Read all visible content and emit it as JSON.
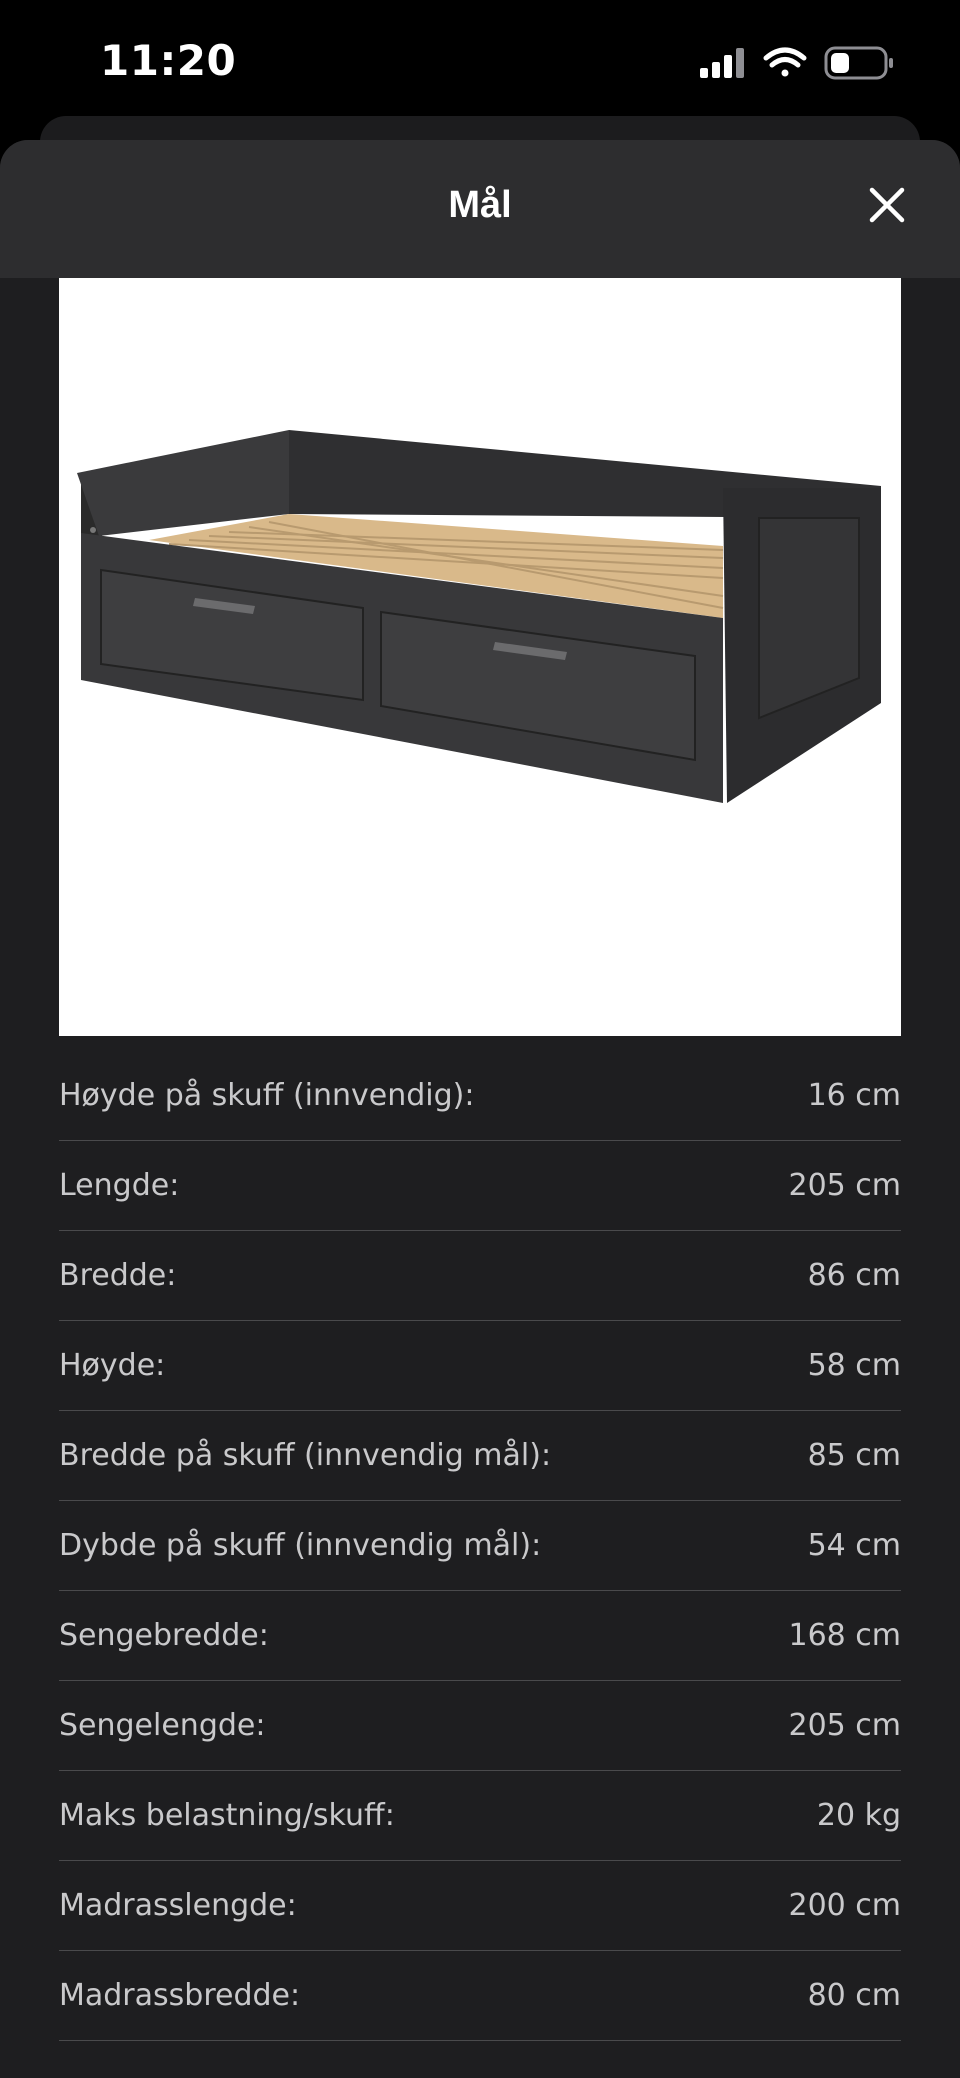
{
  "status_bar": {
    "time": "11:20",
    "icons": [
      "signal-icon",
      "wifi-icon",
      "battery-icon"
    ]
  },
  "sheet": {
    "title": "Mål",
    "close_icon": "close-icon"
  },
  "product_image": {
    "description_icon": "daybed-with-drawers-image"
  },
  "specs": [
    {
      "label": "Høyde på skuff (innvendig):",
      "value": "16 cm"
    },
    {
      "label": "Lengde:",
      "value": "205 cm"
    },
    {
      "label": "Bredde:",
      "value": "86 cm"
    },
    {
      "label": "Høyde:",
      "value": "58 cm"
    },
    {
      "label": "Bredde på skuff (innvendig mål):",
      "value": "85 cm"
    },
    {
      "label": "Dybde på skuff (innvendig mål):",
      "value": "54 cm"
    },
    {
      "label": "Sengebredde:",
      "value": "168 cm"
    },
    {
      "label": "Sengelengde:",
      "value": "205 cm"
    },
    {
      "label": "Maks belastning/skuff:",
      "value": "20 kg"
    },
    {
      "label": "Madrasslengde:",
      "value": "200 cm"
    },
    {
      "label": "Madrassbredde:",
      "value": "80 cm"
    }
  ],
  "colors": {
    "background": "#000000",
    "sheet": "#1e1e20",
    "header": "#2d2d2f",
    "text": "#c9c9cb",
    "divider": "#4a4a4c"
  }
}
